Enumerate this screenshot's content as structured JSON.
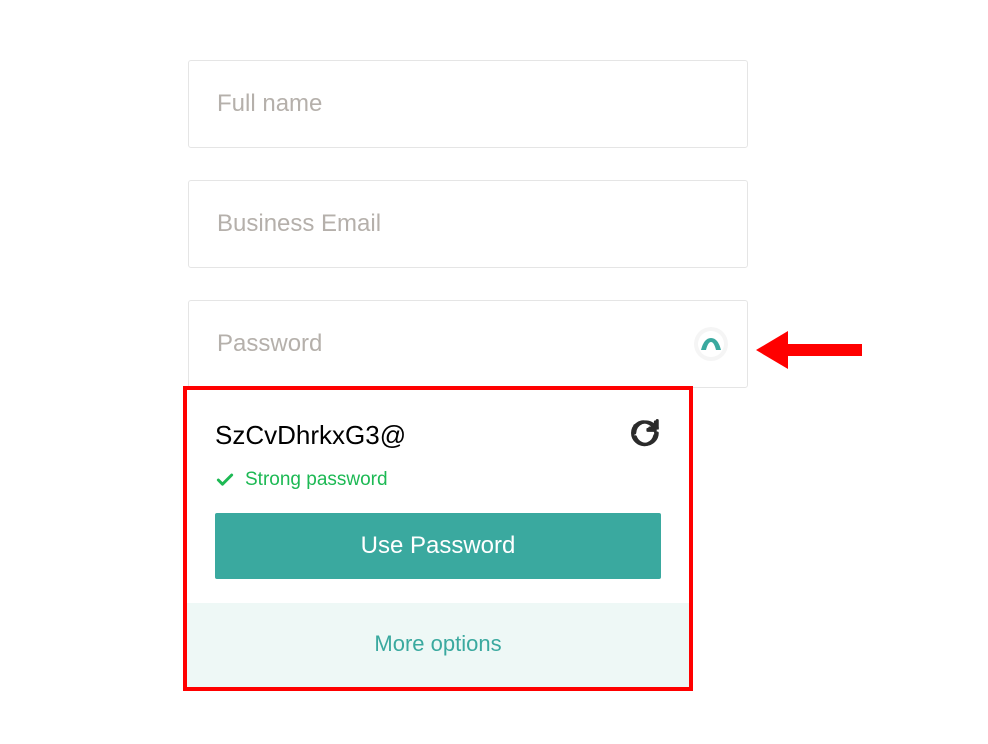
{
  "form": {
    "fullname_placeholder": "Full name",
    "email_placeholder": "Business Email",
    "password_placeholder": "Password"
  },
  "popup": {
    "generated_password": "SzCvDhrkxG3@",
    "strength_label": "Strong password",
    "use_button_label": "Use Password",
    "more_options_label": "More options"
  },
  "colors": {
    "accent": "#3aa99f",
    "strength_green": "#1db954",
    "highlight_red": "#ff0000"
  }
}
